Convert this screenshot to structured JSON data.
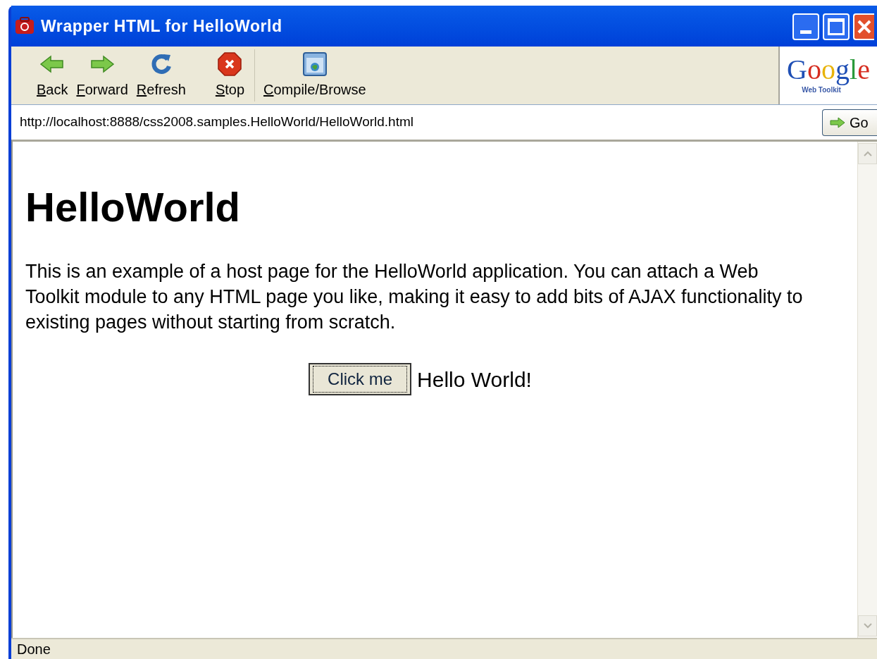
{
  "window": {
    "title": "Wrapper HTML for HelloWorld"
  },
  "toolbar": {
    "buttons": [
      {
        "label": "Back",
        "kind": "back"
      },
      {
        "label": "Forward",
        "kind": "forward"
      },
      {
        "label": "Refresh",
        "kind": "refresh"
      },
      {
        "label": "Stop",
        "kind": "stop"
      },
      {
        "label": "Compile/Browse",
        "kind": "compile"
      }
    ],
    "logo": {
      "name": "Google",
      "subtitle": "Web Toolkit"
    }
  },
  "address_bar": {
    "value": "http://localhost:8888/css2008.samples.HelloWorld/HelloWorld.html",
    "go_button": "Go"
  },
  "page": {
    "heading": "HelloWorld",
    "paragraph": "This is an example of a host page for the HelloWorld application. You can attach a Web Toolkit module to any HTML page you like, making it easy to add bits of AJAX functionality to existing pages without starting from scratch.",
    "button": "Click me",
    "message": "Hello World!"
  },
  "status_bar": "Done"
}
